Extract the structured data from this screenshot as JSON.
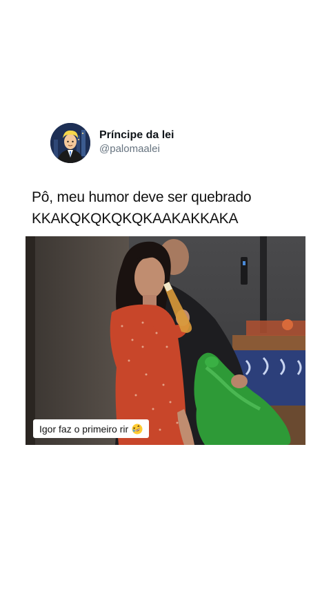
{
  "tweet": {
    "author": {
      "display_name": "Príncipe da lei",
      "handle": "@palomaalei",
      "avatar_icon": "avatar-cartoon-man-icon"
    },
    "text_lines": [
      "Pô, meu humor deve ser quebrado",
      "KKAKQKQKQKQKAAKAKKAKA"
    ],
    "media": {
      "type": "video-frame",
      "caption": "Igor faz o primeiro rir",
      "caption_emoji": "rolling-on-floor-laughing-icon"
    }
  },
  "colors": {
    "background": "#ffffff",
    "text": "#0f1419",
    "handle": "#66737f",
    "dress": "#c8462a",
    "inflatable": "#2e9a37"
  }
}
